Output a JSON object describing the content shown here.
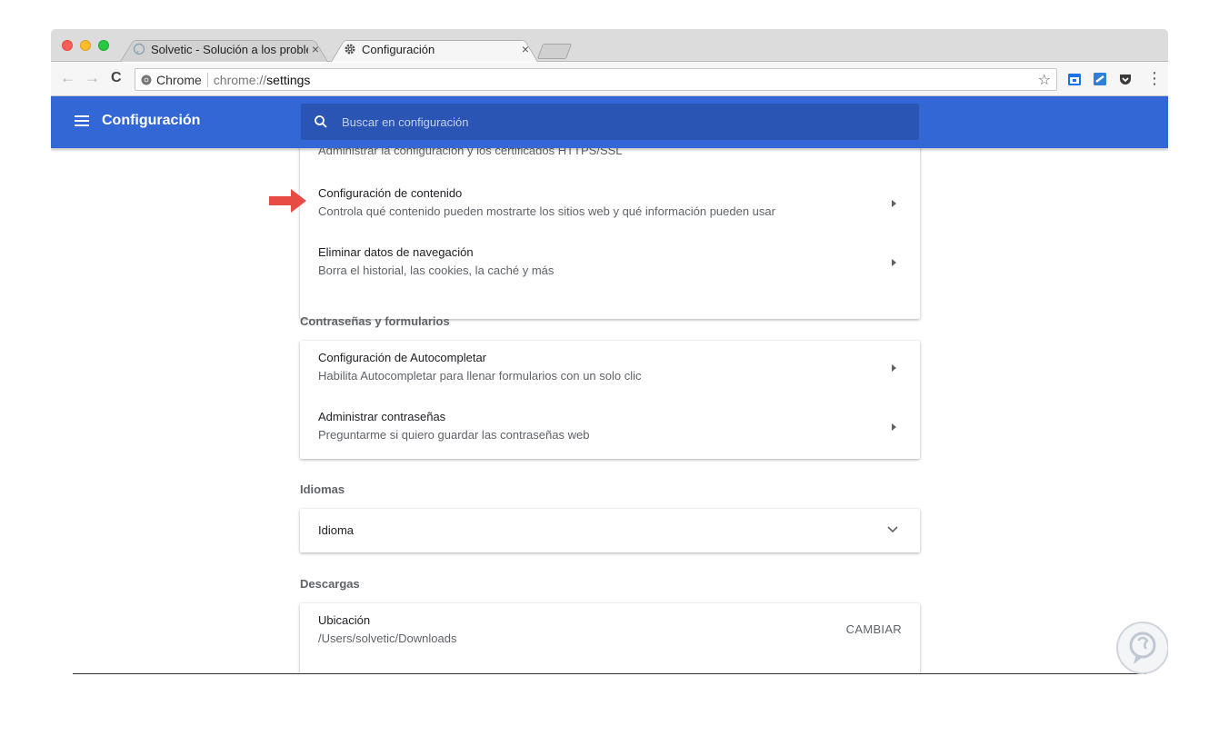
{
  "window": {
    "tabs": [
      {
        "title": "Solvetic - Solución a los proble",
        "close": "×",
        "active": false
      },
      {
        "title": "Configuración",
        "close": "×",
        "active": true
      }
    ]
  },
  "toolbar": {
    "back": "←",
    "forward": "→",
    "reload": "C",
    "omnibox": {
      "site_label": "Chrome",
      "scheme": "chrome://",
      "path": "settings"
    },
    "star": "☆",
    "menu": "⋮"
  },
  "header": {
    "title": "Configuración",
    "search_placeholder": "Buscar en configuración"
  },
  "privacy": {
    "items": [
      {
        "title": "",
        "subtitle": "Administrar la configuración y los certificados HTTPS/SSL"
      },
      {
        "title": "Configuración de contenido",
        "subtitle": "Controla qué contenido pueden mostrarte los sitios web y qué información pueden usar"
      },
      {
        "title": "Eliminar datos de navegación",
        "subtitle": "Borra el historial, las cookies, la caché y más"
      }
    ]
  },
  "passwords": {
    "heading": "Contraseñas y formularios",
    "items": [
      {
        "title": "Configuración de Autocompletar",
        "subtitle": "Habilita Autocompletar para llenar formularios con un solo clic"
      },
      {
        "title": "Administrar contraseñas",
        "subtitle": "Preguntarme si quiero guardar las contraseñas web"
      }
    ]
  },
  "languages": {
    "heading": "Idiomas",
    "item": "Idioma"
  },
  "downloads": {
    "heading": "Descargas",
    "location_label": "Ubicación",
    "location_value": "/Users/solvetic/Downloads",
    "change_button": "CAMBIAR"
  },
  "colors": {
    "header_blue": "#3367d6",
    "search_blue": "#2a55b4",
    "annotation_red": "#e84b44"
  }
}
